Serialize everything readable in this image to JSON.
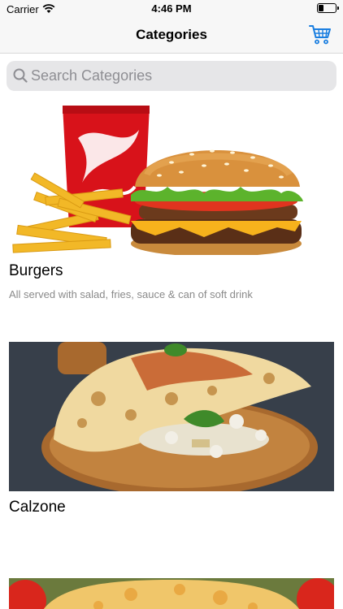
{
  "status_bar": {
    "carrier": "Carrier",
    "time": "4:46 PM",
    "battery_level": 0.3
  },
  "nav": {
    "title": "Categories",
    "cart_icon": "cart-icon",
    "accent_color": "#1a7ee0"
  },
  "search": {
    "placeholder": "Search Categories",
    "value": ""
  },
  "categories": [
    {
      "name": "Burgers",
      "description": "All served with salad, fries, sauce & can of soft drink",
      "image": "burger-with-fries-and-cola"
    },
    {
      "name": "Calzone",
      "description": "",
      "image": "calzone-on-wooden-board"
    },
    {
      "name": "",
      "description": "",
      "image": "pizza-with-tomatoes"
    }
  ]
}
